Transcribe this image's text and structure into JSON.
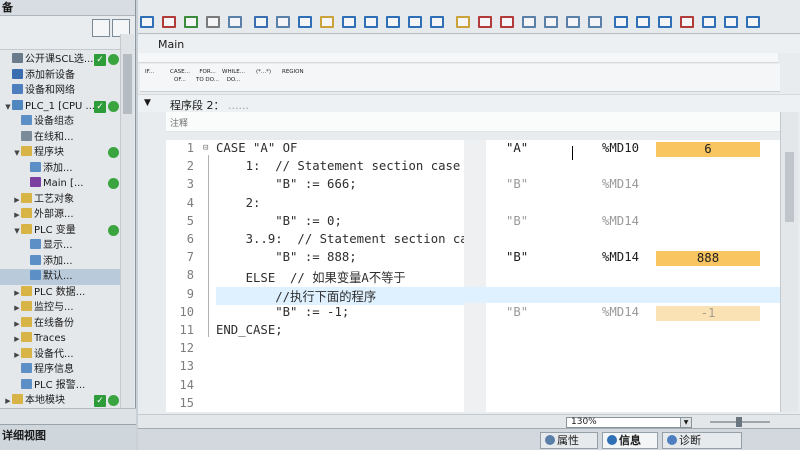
{
  "left_panel": {
    "title": "备",
    "tree": [
      {
        "label": "公开课SCL选...",
        "exp": "",
        "icon": "project-icon",
        "color": "#6a7c8c",
        "check": true,
        "dot": true,
        "sel": false
      },
      {
        "label": "添加新设备",
        "exp": "",
        "icon": "add-device-icon",
        "color": "#3b6db1",
        "check": false,
        "dot": false,
        "sel": false
      },
      {
        "label": "设备和网络",
        "exp": "",
        "icon": "network-icon",
        "color": "#4d7fbf",
        "check": false,
        "dot": false,
        "sel": false
      },
      {
        "label": "PLC_1 [CPU ...",
        "exp": "▼",
        "icon": "plc-icon",
        "color": "#4f86bf",
        "check": true,
        "dot": true,
        "sel": false
      },
      {
        "label": "设备组态",
        "exp": "",
        "icon": "device-config-icon",
        "color": "#5b8fc6",
        "check": false,
        "dot": false,
        "sel": false
      },
      {
        "label": "在线和...",
        "exp": "",
        "icon": "online-diag-icon",
        "color": "#7b8b99",
        "check": false,
        "dot": false,
        "sel": false
      },
      {
        "label": "程序块",
        "exp": "▼",
        "icon": "folder-icon",
        "color": "#d8b446",
        "check": false,
        "dot": true,
        "sel": false
      },
      {
        "label": "添加...",
        "exp": "",
        "icon": "add-block-icon",
        "color": "#5b8fc6",
        "check": false,
        "dot": false,
        "sel": false
      },
      {
        "label": "Main [...",
        "exp": "",
        "icon": "ob-icon",
        "color": "#7a3fa0",
        "check": false,
        "dot": true,
        "sel": false
      },
      {
        "label": "工艺对象",
        "exp": "▶",
        "icon": "folder-icon",
        "color": "#d8b446",
        "check": false,
        "dot": false,
        "sel": false
      },
      {
        "label": "外部源...",
        "exp": "▶",
        "icon": "folder-icon",
        "color": "#d8b446",
        "check": false,
        "dot": false,
        "sel": false
      },
      {
        "label": "PLC 变量",
        "exp": "▼",
        "icon": "folder-icon",
        "color": "#d8b446",
        "check": false,
        "dot": true,
        "sel": false
      },
      {
        "label": "显示...",
        "exp": "",
        "icon": "tag-table-icon",
        "color": "#5b8fc6",
        "check": false,
        "dot": false,
        "sel": false
      },
      {
        "label": "添加...",
        "exp": "",
        "icon": "add-tag-icon",
        "color": "#5b8fc6",
        "check": false,
        "dot": false,
        "sel": false
      },
      {
        "label": "默认...",
        "exp": "",
        "icon": "tag-table-icon",
        "color": "#5b8fc6",
        "check": false,
        "dot": false,
        "sel": true
      },
      {
        "label": "PLC 数据...",
        "exp": "▶",
        "icon": "folder-icon",
        "color": "#d8b446",
        "check": false,
        "dot": false,
        "sel": false
      },
      {
        "label": "监控与...",
        "exp": "▶",
        "icon": "folder-icon",
        "color": "#d8b446",
        "check": false,
        "dot": false,
        "sel": false
      },
      {
        "label": "在线备份",
        "exp": "▶",
        "icon": "folder-icon",
        "color": "#d8b446",
        "check": false,
        "dot": false,
        "sel": false
      },
      {
        "label": "Traces",
        "exp": "▶",
        "icon": "folder-icon",
        "color": "#d8b446",
        "check": false,
        "dot": false,
        "sel": false
      },
      {
        "label": "设备代...",
        "exp": "▶",
        "icon": "folder-icon",
        "color": "#d8b446",
        "check": false,
        "dot": false,
        "sel": false
      },
      {
        "label": "程序信息",
        "exp": "",
        "icon": "program-info-icon",
        "color": "#5b8fc6",
        "check": false,
        "dot": false,
        "sel": false
      },
      {
        "label": "PLC 报警...",
        "exp": "",
        "icon": "alarm-icon",
        "color": "#5b8fc6",
        "check": false,
        "dot": false,
        "sel": false
      },
      {
        "label": "本地模块",
        "exp": "▶",
        "icon": "folder-icon",
        "color": "#d8b446",
        "check": true,
        "dot": true,
        "sel": false
      }
    ],
    "detail_view_label": "详细视图"
  },
  "editor": {
    "block_name": "Main",
    "instructions": [
      {
        "l1": "IF...",
        "l2": ""
      },
      {
        "l1": "CASE...",
        "l2": "OF..."
      },
      {
        "l1": "FOR...",
        "l2": "TO DO..."
      },
      {
        "l1": "WHILE...",
        "l2": "DO..."
      },
      {
        "l1": "(*...*)",
        "l2": ""
      },
      {
        "l1": "REGION",
        "l2": ""
      }
    ],
    "network_title": "程序段 2：",
    "network_title_extra": "......",
    "comment_placeholder": "注释",
    "code_lines": [
      {
        "n": "1",
        "text": "CASE \"A\" OF",
        "fold": "⊟"
      },
      {
        "n": "2",
        "text": "    1:  // Statement section case 1",
        "fold": ""
      },
      {
        "n": "3",
        "text": "        \"B\" := 666;",
        "fold": ""
      },
      {
        "n": "4",
        "text": "    2:",
        "fold": ""
      },
      {
        "n": "5",
        "text": "        \"B\" := 0;",
        "fold": ""
      },
      {
        "n": "6",
        "text": "    3..9:  // Statement section case 3 to 9",
        "fold": ""
      },
      {
        "n": "7",
        "text": "        \"B\" := 888;",
        "fold": ""
      },
      {
        "n": "8",
        "text": "    ELSE  // 如果变量A不等于",
        "fold": ""
      },
      {
        "n": "9",
        "text": "        //执行下面的程序",
        "fold": ""
      },
      {
        "n": "10",
        "text": "        \"B\" := -1;",
        "fold": ""
      },
      {
        "n": "11",
        "text": "END_CASE;",
        "fold": ""
      },
      {
        "n": "12",
        "text": "",
        "fold": ""
      },
      {
        "n": "13",
        "text": "",
        "fold": ""
      },
      {
        "n": "14",
        "text": "",
        "fold": ""
      },
      {
        "n": "15",
        "text": "",
        "fold": ""
      }
    ],
    "monitor_rows": [
      {
        "line": 1,
        "tag": "\"A\"",
        "address": "%MD10",
        "value": "6",
        "active": true
      },
      {
        "line": 3,
        "tag": "\"B\"",
        "address": "%MD14",
        "value": "",
        "active": false
      },
      {
        "line": 5,
        "tag": "\"B\"",
        "address": "%MD14",
        "value": "",
        "active": false
      },
      {
        "line": 7,
        "tag": "\"B\"",
        "address": "%MD14",
        "value": "888",
        "active": true
      },
      {
        "line": 10,
        "tag": "\"B\"",
        "address": "%MD14",
        "value": "-1",
        "active": false
      }
    ],
    "zoom": "130%"
  },
  "status_tabs": [
    {
      "label": "属性",
      "icon": "properties-icon",
      "color": "#5a7fa8",
      "active": false
    },
    {
      "label": "信息",
      "icon": "info-icon",
      "color": "#2f6fb5",
      "active": true
    },
    {
      "label": "诊断",
      "icon": "diagnostics-icon",
      "color": "#4d7fbf",
      "active": false
    }
  ],
  "colors": {
    "monitor_active": "#f9c561",
    "monitor_inactive": "#fbe2b4",
    "status_ok_green": "#2f9c3a"
  }
}
